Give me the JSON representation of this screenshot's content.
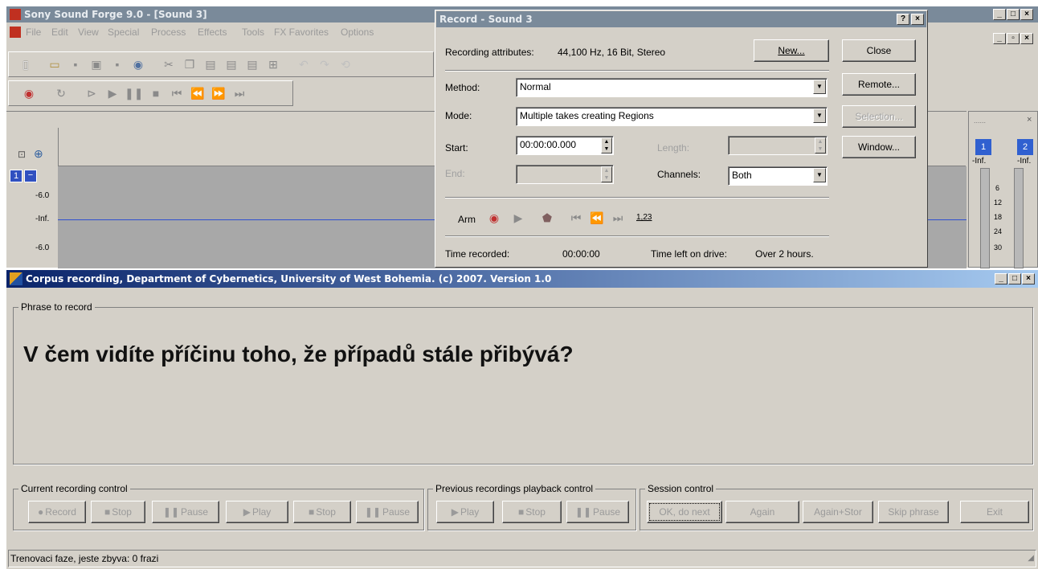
{
  "soundforge": {
    "title": "Sony Sound Forge 9.0 - [Sound 3]",
    "menu": [
      "File",
      "Edit",
      "View",
      "Special",
      "Process",
      "Effects",
      "Tools",
      "FX Favorites",
      "Options"
    ],
    "ruler_labels": [
      "-6.0",
      "-Inf.",
      "-6.0"
    ],
    "channel_number": "1"
  },
  "record_dialog": {
    "title": "Record - Sound 3",
    "help_btn": "?",
    "close_x": "×",
    "attributes_label": "Recording attributes:",
    "attributes_value": "44,100 Hz, 16 Bit, Stereo",
    "new_btn": "New...",
    "close_btn": "Close",
    "remote_btn": "Remote...",
    "selection_btn": "Selection...",
    "window_btn": "Window...",
    "method_label": "Method:",
    "method_value": "Normal",
    "mode_label": "Mode:",
    "mode_value": "Multiple takes creating Regions",
    "start_label": "Start:",
    "start_value": "00:00:00.000",
    "length_label": "Length:",
    "end_label": "End:",
    "channels_label": "Channels:",
    "channels_value": "Both",
    "arm_label": "Arm",
    "counter_icon": "1,23",
    "time_recorded_label": "Time recorded:",
    "time_recorded_value": "00:00:00",
    "time_left_label": "Time left on drive:",
    "time_left_value": "Over 2 hours."
  },
  "meter_panel": {
    "ch1": "1",
    "ch2": "2",
    "inf1": "-Inf.",
    "inf2": "-Inf.",
    "scale": [
      "6",
      "12",
      "18",
      "24",
      "30"
    ]
  },
  "corpus": {
    "title": "Corpus recording, Department of Cybernetics, University of West Bohemia. (c) 2007. Version 1.0",
    "phrase_group": "Phrase to record",
    "phrase": "V čem vidíte příčinu toho, že případů stále přibývá?",
    "current_group": "Current recording control",
    "previous_group": "Previous recordings playback control",
    "session_group": "Session control",
    "current_buttons": [
      "Record",
      "Stop",
      "Pause",
      "Play",
      "Stop",
      "Pause"
    ],
    "previous_buttons": [
      "Play",
      "Stop",
      "Pause"
    ],
    "session_buttons": [
      "OK, do next",
      "Again",
      "Again+Stor",
      "Skip phrase",
      "Exit"
    ],
    "status": "Trenovaci faze, jeste zbyva: 0 frazi"
  }
}
